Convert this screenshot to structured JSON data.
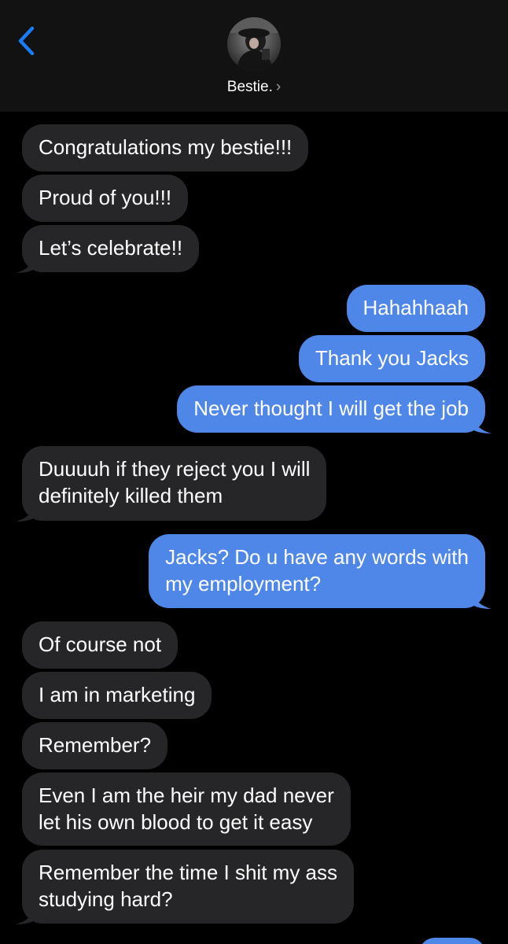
{
  "header": {
    "contact_name": "Bestie.",
    "chevron": "›",
    "back_icon": "chevron-left-icon",
    "accent_color": "#1a7cf5"
  },
  "messages": [
    {
      "from": "them",
      "text": "Congratulations my bestie!!!"
    },
    {
      "from": "them",
      "text": "Proud of you!!!"
    },
    {
      "from": "them",
      "text": "Let’s celebrate!!"
    },
    {
      "from": "me",
      "text": "Hahahhaah"
    },
    {
      "from": "me",
      "text": "Thank you Jacks"
    },
    {
      "from": "me",
      "text": "Never thought I will get the job"
    },
    {
      "from": "them",
      "lines": [
        "Duuuuh if they reject you I will",
        "definitely killed them"
      ]
    },
    {
      "from": "me",
      "lines": [
        "Jacks? Do u have any words with",
        "my employment?"
      ]
    },
    {
      "from": "them",
      "text": "Of course not"
    },
    {
      "from": "them",
      "text": "I am in marketing"
    },
    {
      "from": "them",
      "text": "Remember?"
    },
    {
      "from": "them",
      "lines": [
        "Even I am the heir my dad never",
        "let his own blood to get it easy"
      ]
    },
    {
      "from": "them",
      "lines": [
        "Remember the time I shit my ass",
        "studying hard?"
      ]
    }
  ],
  "colors": {
    "received_bubble": "#262628",
    "sent_bubble": "#4f87e8",
    "header_bg": "#121212"
  }
}
